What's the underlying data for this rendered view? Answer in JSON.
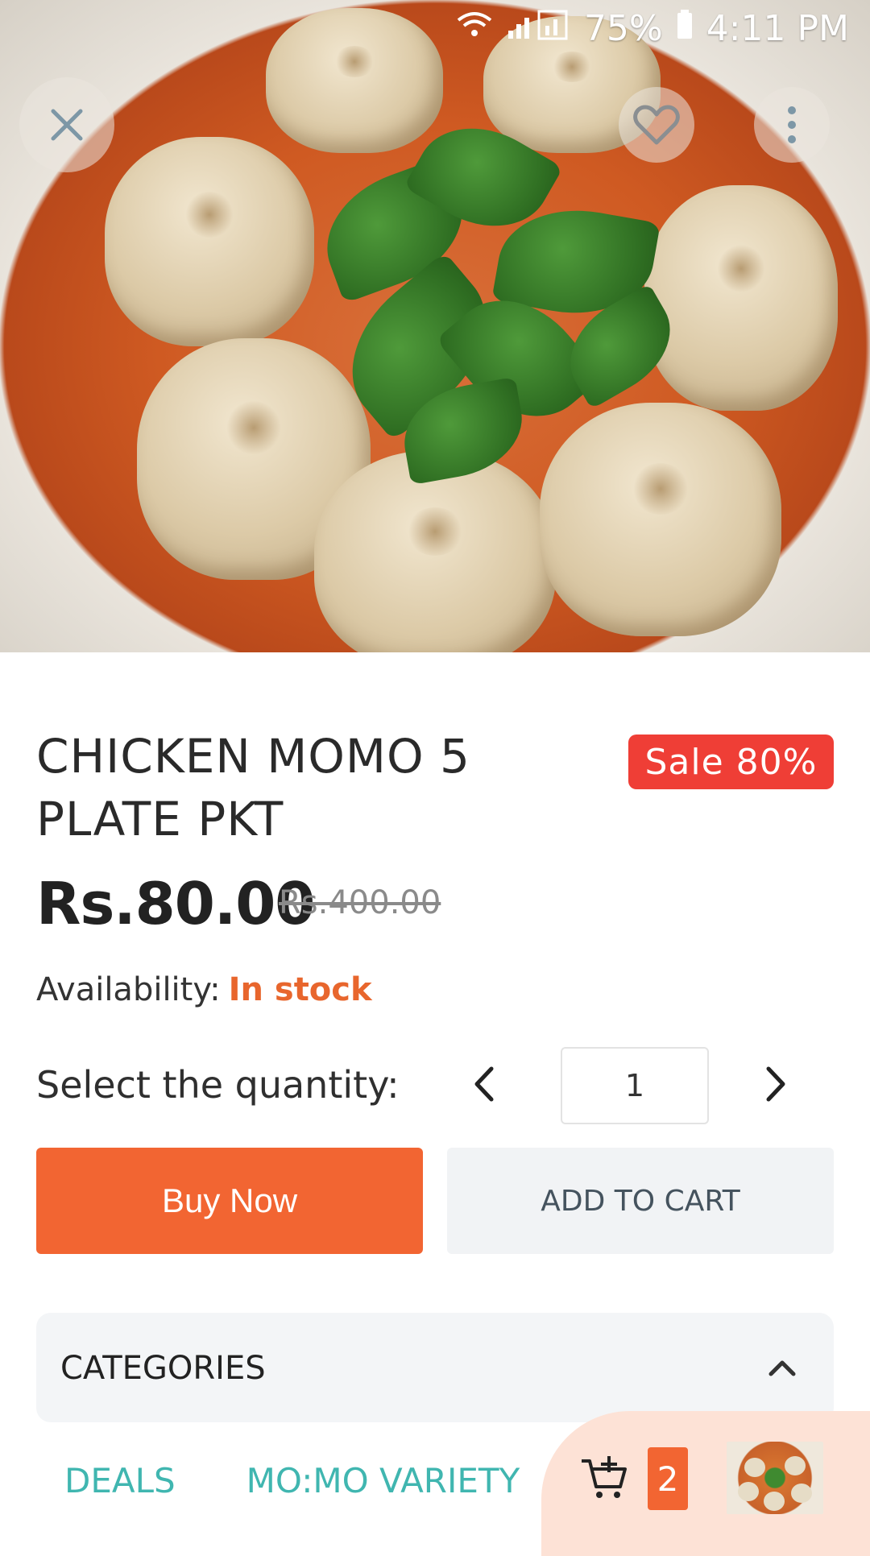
{
  "status_bar": {
    "battery": "75%",
    "time": "4:11 PM"
  },
  "product": {
    "title": "CHICKEN MOMO 5 PLATE PKT",
    "sale_badge": "Sale 80%",
    "price": "Rs.80.00",
    "old_price": "Rs.400.00",
    "availability_label": "Availability:",
    "availability_value": "In stock"
  },
  "quantity": {
    "label": "Select the quantity:",
    "value": "1"
  },
  "actions": {
    "buy_now": "Buy Now",
    "add_to_cart": "ADD TO CART"
  },
  "categories": {
    "header": "CATEGORIES",
    "links": [
      "DEALS",
      "MO:MO VARIETY"
    ]
  },
  "cart": {
    "count": "2"
  },
  "colors": {
    "accent": "#f26532",
    "sale": "#ef3e36",
    "in_stock": "#e8662d",
    "category_link": "#40b6b0"
  }
}
